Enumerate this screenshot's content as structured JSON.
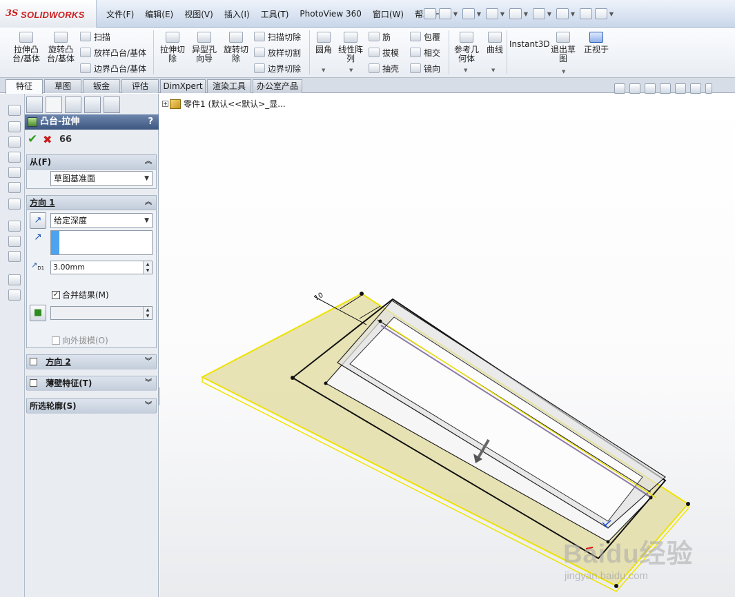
{
  "app": {
    "logo_text": "SOLIDWORKS",
    "logo_prefix": "3S"
  },
  "menu": [
    "文件(F)",
    "编辑(E)",
    "视图(V)",
    "插入(I)",
    "工具(T)",
    "PhotoView 360",
    "窗口(W)",
    "帮助(H)"
  ],
  "commands": {
    "extrude_boss": "拉伸凸\n台/基体",
    "revolve_boss": "旋转凸\n台/基体",
    "sweep": "扫描",
    "loft_boss": "放样凸台/基体",
    "boundary_boss": "边界凸台/基体",
    "extrude_cut": "拉伸切\n除",
    "hole_wizard": "异型孔\n向导",
    "revolve_cut": "旋转切\n除",
    "swept_cut": "扫描切除",
    "lofted_cut": "放样切割",
    "boundary_cut": "边界切除",
    "fillet": "圆角",
    "linear_pattern": "线性阵\n列",
    "rib": "筋",
    "draft": "拔模",
    "shell": "抽壳",
    "wrap": "包覆",
    "intersect": "相交",
    "mirror": "镜向",
    "ref_geometry": "参考几\n何体",
    "curves": "曲线",
    "instant3d": "Instant3D",
    "exit_sketch": "退出草\n图",
    "normal_to": "正视于"
  },
  "tabs": [
    "特征",
    "草图",
    "钣金",
    "评估",
    "DimXpert",
    "渲染工具",
    "办公室产品"
  ],
  "active_tab": "特征",
  "feature_tree": {
    "root_label": "零件1  (默认<<默认>_显..."
  },
  "property_manager": {
    "title": "凸台-拉伸",
    "help": "?",
    "from": {
      "label": "从(F)",
      "value": "草图基准面"
    },
    "direction1": {
      "label": "方向 1",
      "end_condition": "给定深度",
      "depth": "3.00mm",
      "merge_result_label": "合并结果(M)",
      "merge_result_checked": true,
      "draft_outward_label": "向外拔模(O)",
      "draft_outward_checked": false
    },
    "direction2": {
      "label": "方向 2",
      "checked": false
    },
    "thin_feature": {
      "label": "薄壁特征(T)",
      "checked": false
    },
    "selected_contours": {
      "label": "所选轮廓(S)"
    }
  },
  "viewport": {
    "dimension_value": "10"
  },
  "watermark": {
    "brand": "Baidu经验",
    "url": "jingyan.baidu.com"
  },
  "colors": {
    "title_gradient_top": "#6d86ad",
    "title_gradient_bottom": "#3c5780",
    "preview_fill": "#e8e2ad",
    "preview_edge": "#f2ea00",
    "selection_blue": "#4da3ef"
  }
}
